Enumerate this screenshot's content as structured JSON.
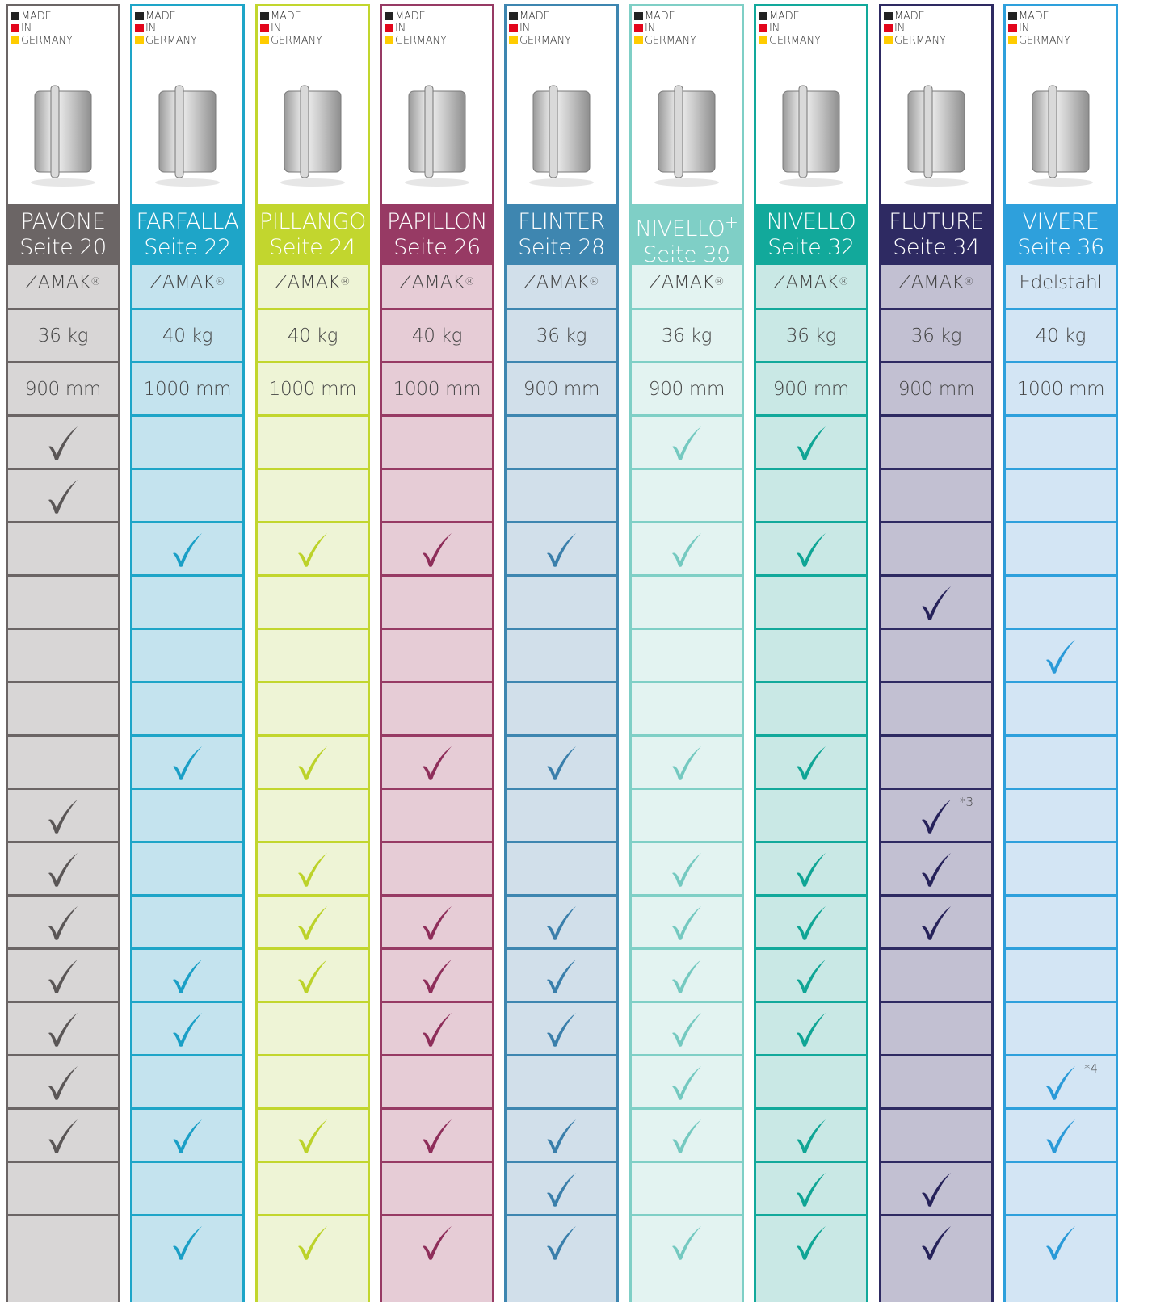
{
  "badge": {
    "line1": "MADE",
    "line2": "IN",
    "line3": "GERMANY"
  },
  "colors": {
    "flag_black": "#222222",
    "flag_red": "#e3051b",
    "flag_gold": "#ffcc00"
  },
  "columns": [
    {
      "name": "PAVONE",
      "page": "Seite 20",
      "material": "ZAMAK",
      "material_reg": "®",
      "load": "36 kg",
      "width": "900 mm",
      "color": "#6b6565",
      "tint": "#d8d6d6",
      "check_color": "#5a5656",
      "checks": [
        1,
        1,
        0,
        0,
        0,
        0,
        0,
        1,
        1,
        1,
        1,
        1,
        1,
        1,
        0,
        0
      ],
      "notes": {}
    },
    {
      "name": "FARFALLA",
      "page": "Seite 22",
      "material": "ZAMAK",
      "material_reg": "®",
      "load": "40 kg",
      "width": "1000 mm",
      "color": "#1ea5c8",
      "tint": "#c4e3ee",
      "check_color": "#1a9fc6",
      "checks": [
        0,
        0,
        1,
        0,
        0,
        0,
        1,
        0,
        0,
        0,
        1,
        1,
        0,
        1,
        0,
        1
      ],
      "notes": {}
    },
    {
      "name": "PILLANGO",
      "page": "Seite 24",
      "material": "ZAMAK",
      "material_reg": "®",
      "load": "40 kg",
      "width": "1000 mm",
      "color": "#c2d62e",
      "tint": "#eef4d6",
      "check_color": "#bcd22a",
      "checks": [
        0,
        0,
        1,
        0,
        0,
        0,
        1,
        0,
        1,
        1,
        1,
        0,
        0,
        1,
        0,
        1
      ],
      "notes": {}
    },
    {
      "name": "PAPILLON",
      "page": "Seite 26",
      "material": "ZAMAK",
      "material_reg": "®",
      "load": "40 kg",
      "width": "1000 mm",
      "color": "#973a64",
      "tint": "#e6ccd6",
      "check_color": "#8e2e5a",
      "checks": [
        0,
        0,
        1,
        0,
        0,
        0,
        1,
        0,
        0,
        1,
        1,
        1,
        0,
        1,
        0,
        1
      ],
      "notes": {}
    },
    {
      "name": "FLINTER",
      "page": "Seite 28",
      "material": "ZAMAK",
      "material_reg": "®",
      "load": "36 kg",
      "width": "900 mm",
      "color": "#3e86b0",
      "tint": "#d1dfea",
      "check_color": "#3a7fab",
      "checks": [
        0,
        0,
        1,
        0,
        0,
        0,
        1,
        0,
        0,
        1,
        1,
        1,
        0,
        1,
        1,
        1
      ],
      "notes": {}
    },
    {
      "name": "NIVELLO",
      "name_sup": "+",
      "page": "Seite 30",
      "material": "ZAMAK",
      "material_reg": "®",
      "load": "36 kg",
      "width": "900 mm",
      "color": "#7fcfc6",
      "tint": "#e3f3f1",
      "check_color": "#74c9c0",
      "checks": [
        1,
        0,
        1,
        0,
        0,
        0,
        1,
        0,
        1,
        1,
        1,
        1,
        1,
        1,
        0,
        1
      ],
      "notes": {}
    },
    {
      "name": "NIVELLO",
      "page": "Seite 32",
      "material": "ZAMAK",
      "material_reg": "®",
      "load": "36 kg",
      "width": "900 mm",
      "color": "#12a99b",
      "tint": "#c9e8e5",
      "check_color": "#0fa595",
      "checks": [
        1,
        0,
        1,
        0,
        0,
        0,
        1,
        0,
        1,
        1,
        1,
        1,
        0,
        1,
        1,
        1
      ],
      "notes": {}
    },
    {
      "name": "FLUTURE",
      "page": "Seite 34",
      "material": "ZAMAK",
      "material_reg": "®",
      "load": "36 kg",
      "width": "900 mm",
      "color": "#2e2a62",
      "tint": "#c2c0d2",
      "check_color": "#26225a",
      "checks": [
        0,
        0,
        0,
        1,
        0,
        0,
        0,
        1,
        1,
        1,
        0,
        0,
        0,
        0,
        1,
        1
      ],
      "notes": {
        "7": "*3"
      }
    },
    {
      "name": "VIVERE",
      "page": "Seite 36",
      "material": "Edelstahl",
      "material_reg": "",
      "load": "40 kg",
      "width": "1000 mm",
      "color": "#2ea0dc",
      "tint": "#d3e5f4",
      "check_color": "#2a9ad8",
      "checks": [
        0,
        0,
        0,
        0,
        1,
        0,
        0,
        0,
        0,
        0,
        0,
        0,
        1,
        1,
        0,
        1
      ],
      "notes": {
        "12": "*4"
      }
    }
  ]
}
